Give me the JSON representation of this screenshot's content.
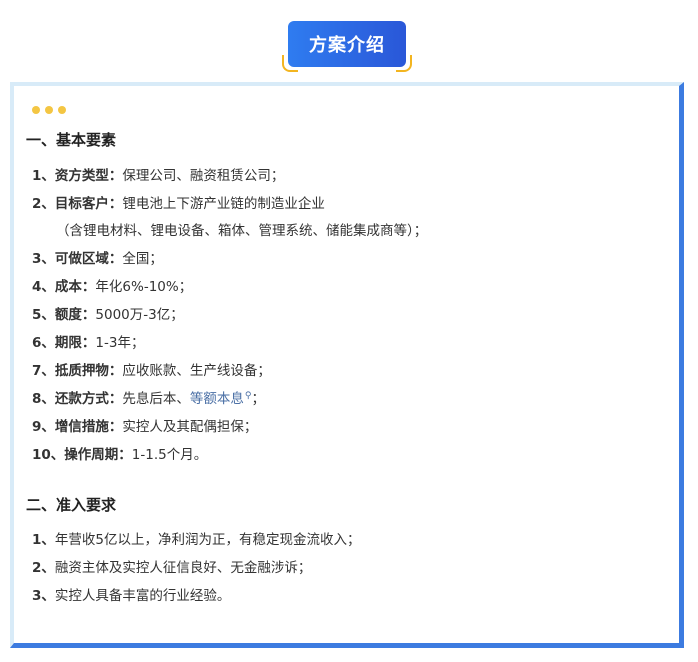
{
  "header": {
    "title": "方案介绍"
  },
  "sections": [
    {
      "title": "一、基本要素",
      "items": [
        {
          "num": "1、",
          "label": "资方类型：",
          "value": "保理公司、融资租赁公司；"
        },
        {
          "num": "2、",
          "label": "目标客户：",
          "value": "锂电池上下游产业链的制造业企业",
          "cont": "（含锂电材料、锂电设备、箱体、管理系统、储能集成商等）；"
        },
        {
          "num": "3、",
          "label": "可做区域：",
          "value": "全国；"
        },
        {
          "num": "4、",
          "label": "成本：",
          "value": "年化6%-10%；"
        },
        {
          "num": "5、",
          "label": "额度：",
          "value": "5000万-3亿；"
        },
        {
          "num": "6、",
          "label": "期限：",
          "value": "1-3年；"
        },
        {
          "num": "7、",
          "label": "抵质押物：",
          "value": "应收账款、生产线设备；"
        },
        {
          "num": "8、",
          "label": "还款方式：",
          "value": "先息后本、",
          "link": "等额本息",
          "suffix": "；"
        },
        {
          "num": "9、",
          "label": "增信措施：",
          "value": "实控人及其配偶担保；"
        },
        {
          "num": "10、",
          "label": "操作周期：",
          "value": "1-1.5个月。"
        }
      ]
    },
    {
      "title": "二、准入要求",
      "items": [
        {
          "num": "1、",
          "value": "年营收5亿以上，净利润为正，有稳定现金流收入；"
        },
        {
          "num": "2、",
          "value": "融资主体及实控人征信良好、无金融涉诉；"
        },
        {
          "num": "3、",
          "value": "实控人具备丰富的行业经验。"
        }
      ]
    }
  ]
}
